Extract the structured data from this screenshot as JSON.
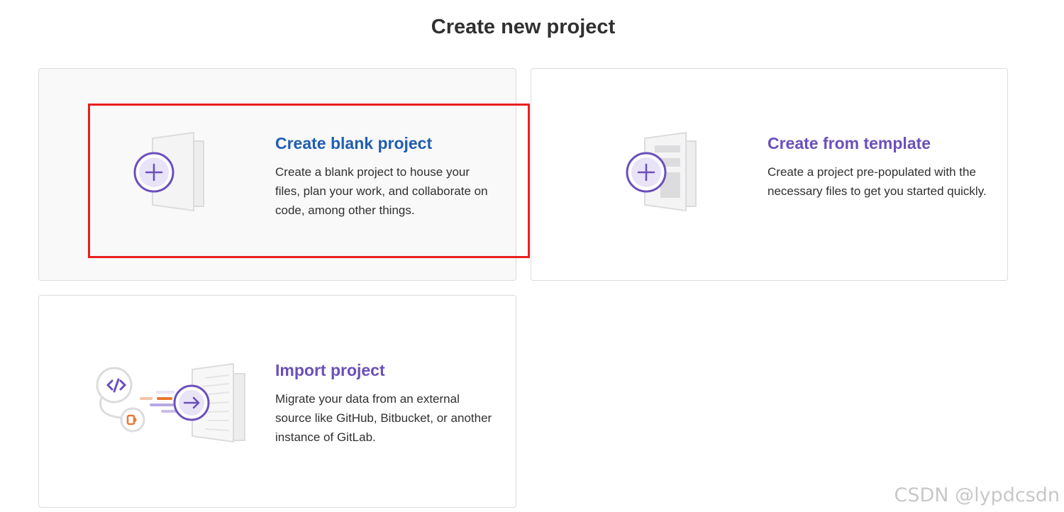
{
  "page": {
    "title": "Create new project"
  },
  "cards": [
    {
      "title": "Create blank project",
      "description": "Create a blank project to house your files, plan your work, and collaborate on code, among other things.",
      "icon": "plus-circle-icon",
      "title_color": "#1f5eb0"
    },
    {
      "title": "Create from template",
      "description": "Create a project pre-populated with the necessary files to get you started quickly.",
      "icon": "plus-circle-icon",
      "title_color": "#6b4fbb"
    },
    {
      "title": "Import project",
      "description": "Migrate your data from an external source like GitHub, Bitbucket, or another instance of GitLab.",
      "icon": "arrow-right-circle-icon",
      "title_color": "#6b4fbb"
    }
  ],
  "watermark": "CSDN @lypdcsdn",
  "colors": {
    "accent_purple": "#6b4fbb",
    "accent_blue": "#1f5eb0",
    "highlight_red": "#e8201c",
    "import_orange": "#e9772f"
  }
}
